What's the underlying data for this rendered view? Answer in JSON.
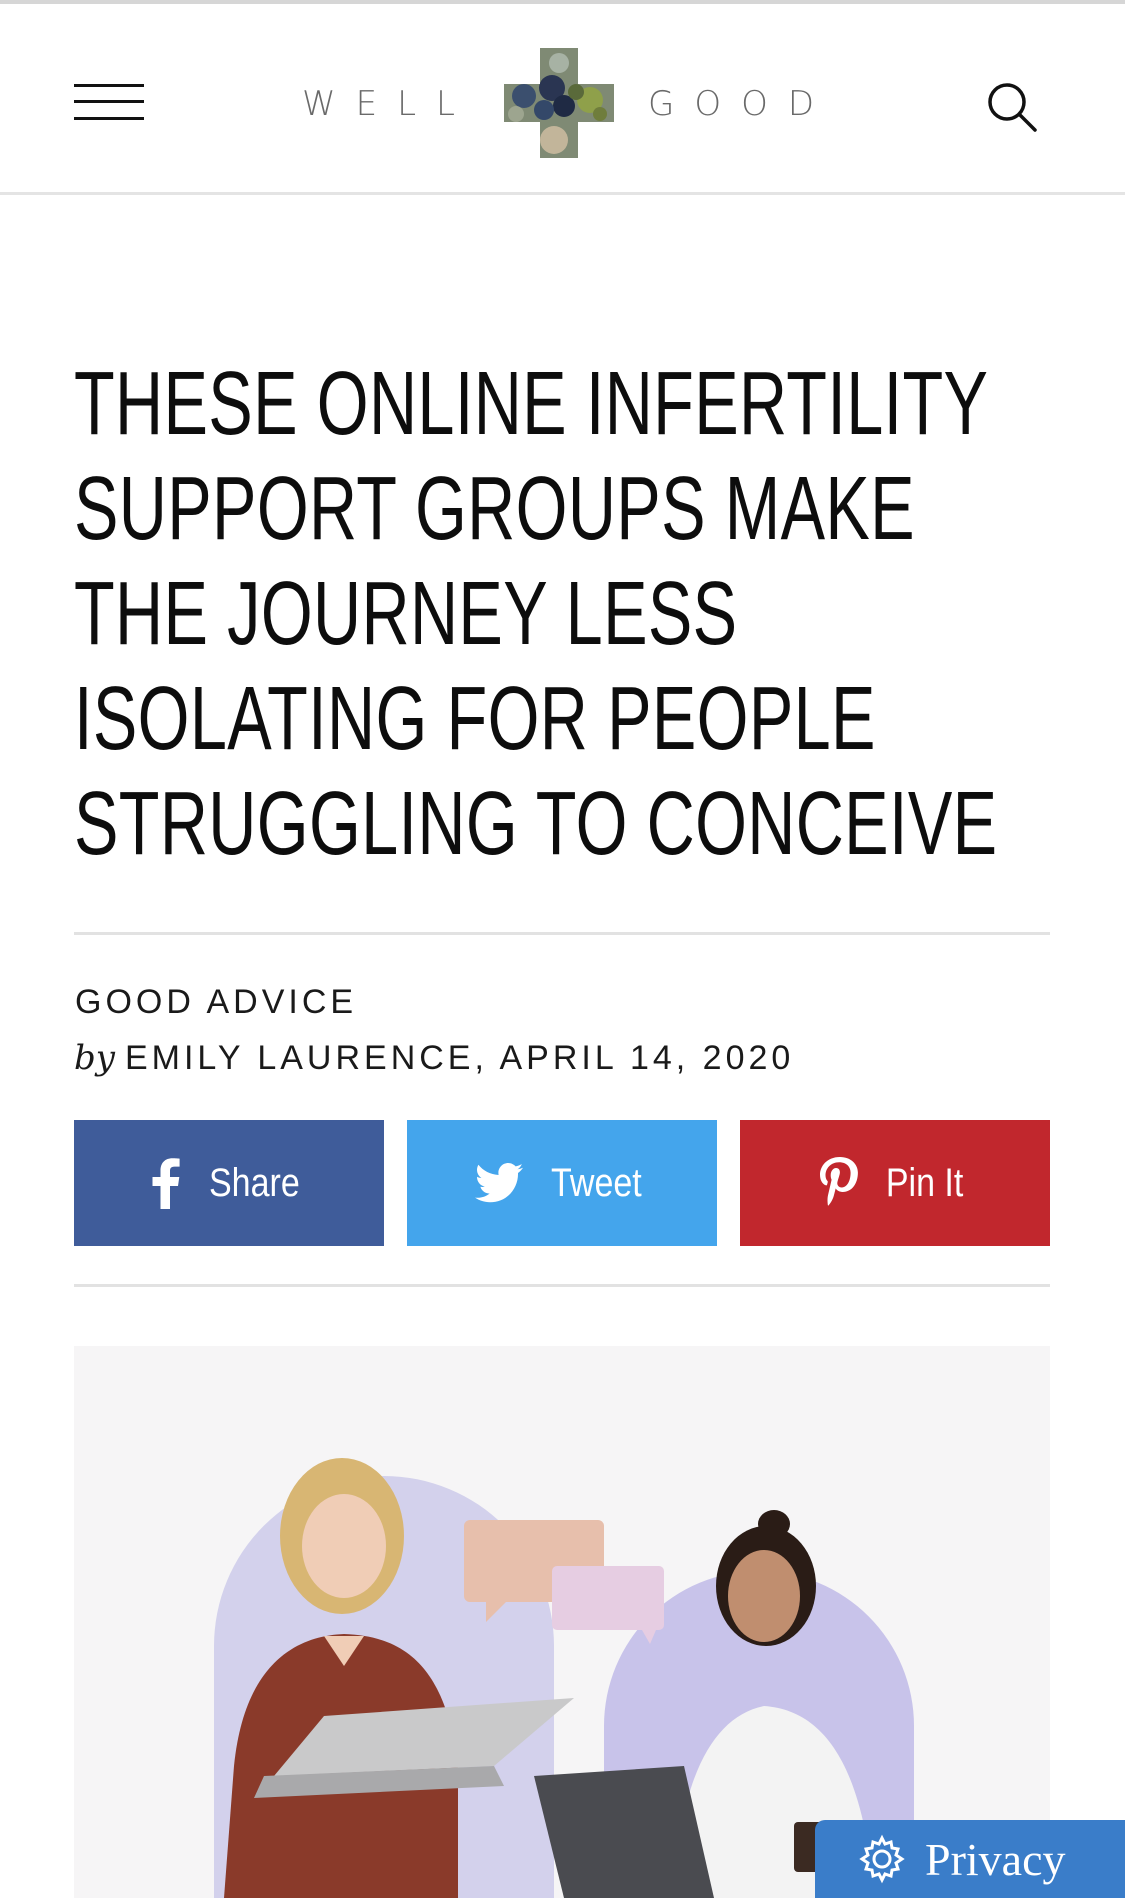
{
  "header": {
    "logo_left": "WELL",
    "logo_right": "GOOD"
  },
  "article": {
    "headline": "These Online Infertility Support Groups Make the Journey Less Isolating for People Struggling to Conceive",
    "category": "GOOD ADVICE",
    "by_prefix": "by",
    "byline": "EMILY LAURENCE, APRIL 14, 2020"
  },
  "share": {
    "facebook_label": "Share",
    "twitter_label": "Tweet",
    "pinterest_label": "Pin It",
    "facebook_color": "#3f5c9a",
    "twitter_color": "#44a5ec",
    "pinterest_color": "#c1272d"
  },
  "privacy": {
    "label": "Privacy",
    "color": "#3a7dc9"
  },
  "icons": {
    "menu": "hamburger-menu-icon",
    "search": "search-icon",
    "facebook": "facebook-icon",
    "twitter": "twitter-icon",
    "pinterest": "pinterest-icon",
    "settings": "gear-icon"
  }
}
